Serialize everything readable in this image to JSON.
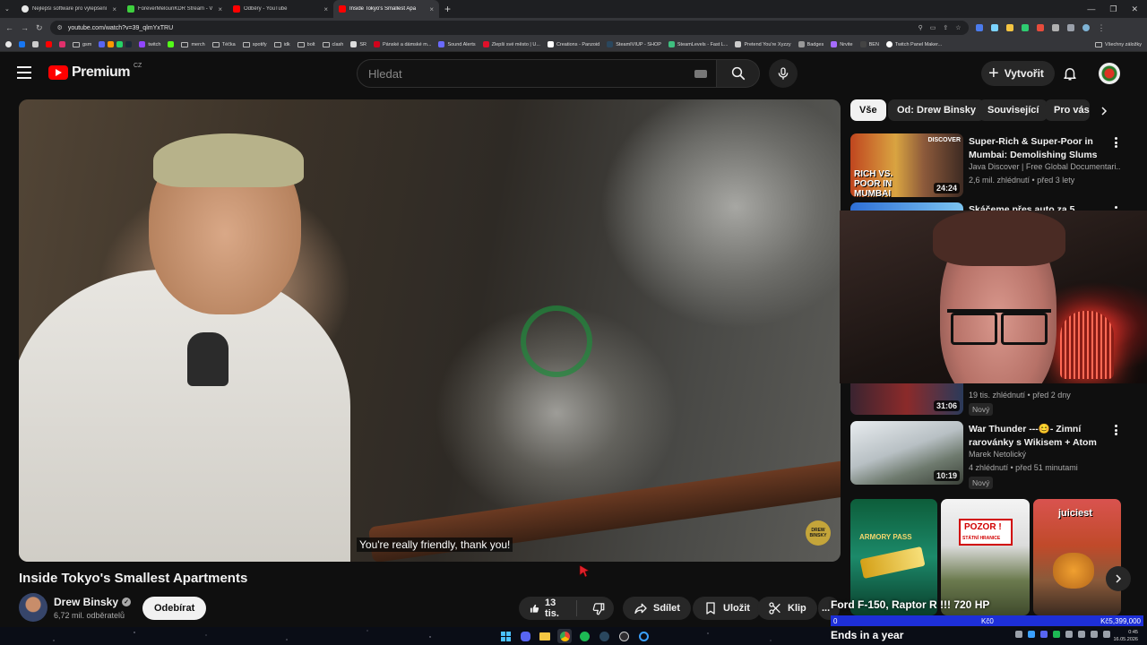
{
  "browser": {
    "tabs": [
      {
        "title": "Nejlepší software pro vylepšení",
        "icon_color": "#e8e8e8"
      },
      {
        "title": "ForeverMelounKDR Stream - V",
        "icon_color": "#3ecf3e"
      },
      {
        "title": "Odběry - YouTube",
        "icon_color": "#ff0000"
      },
      {
        "title": "Inside Tokyo's Smallest Apa",
        "icon_color": "#ff0000",
        "active": true
      }
    ],
    "url": "youtube.com/watch?v=39_qlmYxTRU",
    "bookmarks": [
      "gsm",
      "merch",
      "Téčka",
      "spotify",
      "idk",
      "bolt",
      "clash",
      "SR",
      "Pánské a dámské m...",
      "Sound Alerts",
      "Zlepši své město | U...",
      "Creations - Panzoid",
      "SteamIVIUP - SHOP",
      "SteamLevels - Fast L...",
      "Pretend You're Xyzzy",
      "Badges",
      "Nrvite",
      "BEN",
      "Twitch Panel Maker..."
    ],
    "bookmarks_twitch": "twitch",
    "bookmarks_all": "Všechny záložky"
  },
  "header": {
    "logo_text": "Premium",
    "region": "CZ",
    "search_placeholder": "Hledat",
    "create_label": "Vytvořit"
  },
  "video": {
    "caption": "You're really friendly, thank you!",
    "watermark": "DREW BINSKY",
    "title": "Inside Tokyo's Smallest Apartments",
    "channel": "Drew Binsky",
    "subscribers": "6,72 mil. odběratelů",
    "subscribe_label": "Odebírat",
    "likes": "13 tis.",
    "share_label": "Sdílet",
    "save_label": "Uložit",
    "clip_label": "Klip",
    "more_label": "..."
  },
  "chips": [
    "Vše",
    "Od: Drew Binsky",
    "Související",
    "Pro vás"
  ],
  "recommendations": [
    {
      "title": "Super-Rich & Super-Poor in Mumbai: Demolishing Slums f...",
      "channel": "Java Discover | Free Global Documentari...",
      "meta": "2,6 mil. zhlédnutí • před 3 lety",
      "duration": "24:24",
      "thumb_text": "RICH VS. POOR IN MUMBAI",
      "thumb_tag": "DISCOVER"
    },
    {
      "title": "Skáčeme přes auto za 5",
      "channel": "",
      "meta": "",
      "duration": ""
    },
    {
      "title": "",
      "channel": "",
      "meta": "19 tis. zhlédnutí • před 2 dny",
      "duration": "31:06",
      "badge": "Nový"
    },
    {
      "title": "War Thunder ---😊- Zimní rarovánky s Wikisem + Atom ...",
      "channel": "Marek Netolický",
      "meta": "4 zhlédnutí • před 51 minutami",
      "duration": "10:19",
      "badge": "Nový"
    }
  ],
  "shorts": [
    {
      "label": "ARMORY PASS"
    },
    {
      "label": "POZOR !",
      "sub": "STÁTNÍ HRANICE"
    },
    {
      "label": "juiciest"
    }
  ],
  "stream_overlay": {
    "title": "Ford F-150, Raptor R !!! 720 HP",
    "bar_left": "0",
    "bar_mid": "Kč0",
    "bar_right": "Kč5,399,000",
    "ticker": "Ends in a year"
  },
  "taskbar": {
    "time": "0:45",
    "date": "16.05.2026"
  }
}
